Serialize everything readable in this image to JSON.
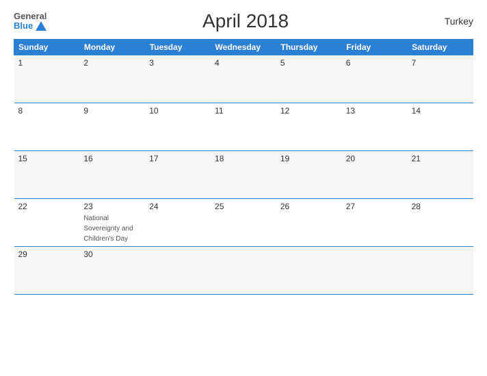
{
  "header": {
    "logo_general": "General",
    "logo_blue": "Blue",
    "title": "April 2018",
    "country": "Turkey"
  },
  "days_of_week": [
    "Sunday",
    "Monday",
    "Tuesday",
    "Wednesday",
    "Thursday",
    "Friday",
    "Saturday"
  ],
  "weeks": [
    [
      {
        "day": "1",
        "event": ""
      },
      {
        "day": "2",
        "event": ""
      },
      {
        "day": "3",
        "event": ""
      },
      {
        "day": "4",
        "event": ""
      },
      {
        "day": "5",
        "event": ""
      },
      {
        "day": "6",
        "event": ""
      },
      {
        "day": "7",
        "event": ""
      }
    ],
    [
      {
        "day": "8",
        "event": ""
      },
      {
        "day": "9",
        "event": ""
      },
      {
        "day": "10",
        "event": ""
      },
      {
        "day": "11",
        "event": ""
      },
      {
        "day": "12",
        "event": ""
      },
      {
        "day": "13",
        "event": ""
      },
      {
        "day": "14",
        "event": ""
      }
    ],
    [
      {
        "day": "15",
        "event": ""
      },
      {
        "day": "16",
        "event": ""
      },
      {
        "day": "17",
        "event": ""
      },
      {
        "day": "18",
        "event": ""
      },
      {
        "day": "19",
        "event": ""
      },
      {
        "day": "20",
        "event": ""
      },
      {
        "day": "21",
        "event": ""
      }
    ],
    [
      {
        "day": "22",
        "event": ""
      },
      {
        "day": "23",
        "event": "National Sovereignty and Children's Day"
      },
      {
        "day": "24",
        "event": ""
      },
      {
        "day": "25",
        "event": ""
      },
      {
        "day": "26",
        "event": ""
      },
      {
        "day": "27",
        "event": ""
      },
      {
        "day": "28",
        "event": ""
      }
    ],
    [
      {
        "day": "29",
        "event": ""
      },
      {
        "day": "30",
        "event": ""
      },
      {
        "day": "",
        "event": ""
      },
      {
        "day": "",
        "event": ""
      },
      {
        "day": "",
        "event": ""
      },
      {
        "day": "",
        "event": ""
      },
      {
        "day": "",
        "event": ""
      }
    ]
  ]
}
